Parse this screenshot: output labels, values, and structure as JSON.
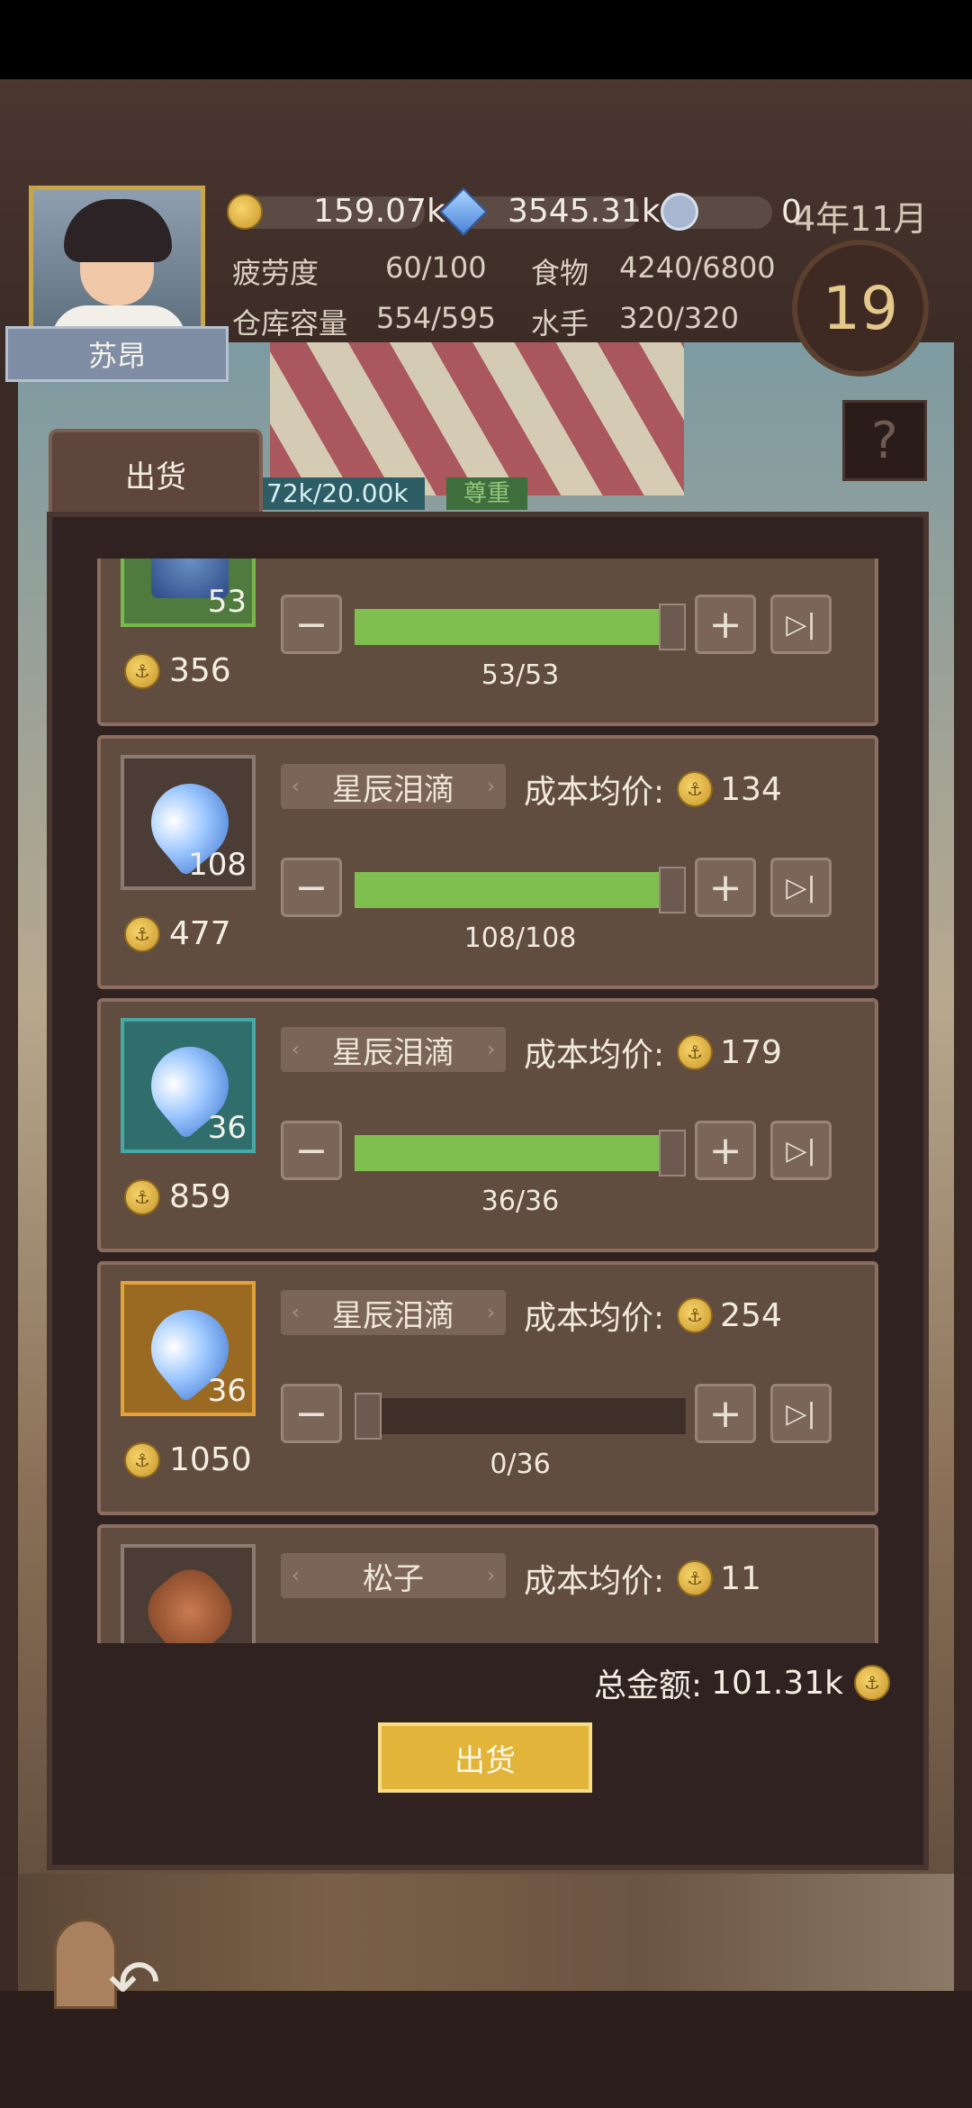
{
  "header": {
    "character_name": "苏昂",
    "gold": "159.07k",
    "gems": "3545.31k",
    "seals": "0",
    "date": "4年11月",
    "day": "19",
    "fatigue_label": "疲劳度",
    "fatigue_value": "60/100",
    "food_label": "食物",
    "food_value": "4240/6800",
    "warehouse_label": "仓库容量",
    "warehouse_value": "554/595",
    "sailors_label": "水手",
    "sailors_value": "320/320",
    "help_label": "?"
  },
  "tab": {
    "label": "出货",
    "reputation_progress": "72k/20.00k",
    "reputation_status": "尊重"
  },
  "items": [
    {
      "quantity": "53",
      "price": "356",
      "count": "53/53",
      "selected": 53,
      "max": 53,
      "slot_color": "#7ab84f"
    },
    {
      "name": "星辰泪滴",
      "cost_label": "成本均价:",
      "cost": "134",
      "quantity": "108",
      "price": "477",
      "count": "108/108",
      "selected": 108,
      "max": 108,
      "slot_color": "#8a7b70"
    },
    {
      "name": "星辰泪滴",
      "cost_label": "成本均价:",
      "cost": "179",
      "quantity": "36",
      "price": "859",
      "count": "36/36",
      "selected": 36,
      "max": 36,
      "slot_color": "#48a8a6"
    },
    {
      "name": "星辰泪滴",
      "cost_label": "成本均价:",
      "cost": "254",
      "quantity": "36",
      "price": "1050",
      "count": "0/36",
      "selected": 0,
      "max": 36,
      "slot_color": "#e0a23a"
    },
    {
      "name": "松子",
      "cost_label": "成本均价:",
      "cost": "11"
    }
  ],
  "footer": {
    "total_label": "总金额:",
    "total_value": "101.31k",
    "ship_button": "出货"
  },
  "icons": {
    "minus": "−",
    "plus": "+",
    "max": "▷|",
    "back": "↶",
    "arrow_left": "‹",
    "arrow_right": "›",
    "coin": "⚓"
  }
}
